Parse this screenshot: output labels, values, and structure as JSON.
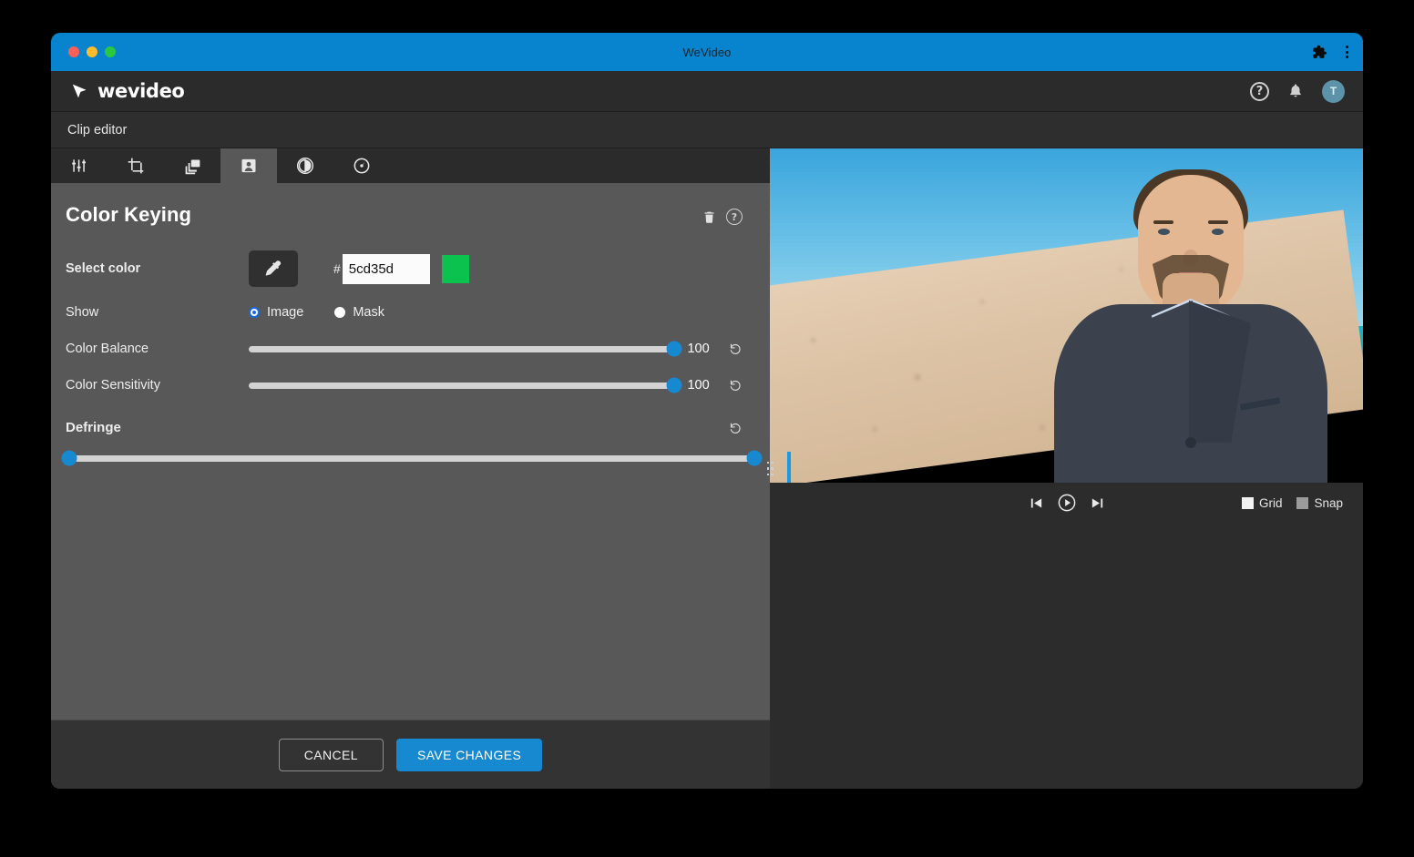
{
  "window": {
    "title": "WeVideo",
    "traffic_lights": [
      "close-red",
      "minimize-yellow",
      "maximize-green"
    ],
    "extensions_icon": "puzzle-icon",
    "menu_icon": "kebab-menu-icon"
  },
  "appbar": {
    "brand": "wevideo",
    "help_label": "?",
    "notifications_icon": "bell-icon",
    "avatar_initial": "T"
  },
  "subbar": {
    "title": "Clip editor"
  },
  "tabs": [
    {
      "id": "adjust",
      "icon": "sliders-icon",
      "active": false
    },
    {
      "id": "crop",
      "icon": "crop-icon",
      "active": false
    },
    {
      "id": "layers",
      "icon": "layers-icon",
      "active": false
    },
    {
      "id": "color-keying",
      "icon": "person-portrait-icon",
      "active": true
    },
    {
      "id": "contrast",
      "icon": "contrast-half-circle-icon",
      "active": false
    },
    {
      "id": "speed",
      "icon": "speedometer-icon",
      "active": false
    }
  ],
  "panel": {
    "title": "Color Keying",
    "delete_icon": "trash-icon",
    "help_icon": "question-circle-icon",
    "select_color": {
      "label": "Select color",
      "eyedropper_icon": "eyedropper-icon",
      "hash": "#",
      "hex_value": "5cd35d",
      "swatch_color": "#0ac24d"
    },
    "show": {
      "label": "Show",
      "options": [
        {
          "label": "Image",
          "selected": true
        },
        {
          "label": "Mask",
          "selected": false
        }
      ]
    },
    "sliders": [
      {
        "label": "Color Balance",
        "value": "100",
        "percent": 100,
        "reset_icon": "reset-arrow-icon"
      },
      {
        "label": "Color Sensitivity",
        "value": "100",
        "percent": 100,
        "reset_icon": "reset-arrow-icon"
      }
    ],
    "defringe": {
      "label": "Defringe",
      "reset_icon": "reset-arrow-icon",
      "range_low_percent": 0,
      "range_high_percent": 100
    }
  },
  "footer": {
    "cancel_label": "CANCEL",
    "save_label": "SAVE CHANGES",
    "save_color": "#1689d1"
  },
  "preview": {
    "drag_handle_icon": "vertical-grip-icon",
    "playhead": true,
    "transport": [
      {
        "id": "skip-start",
        "icon": "skip-to-start-icon"
      },
      {
        "id": "play",
        "icon": "play-circle-icon"
      },
      {
        "id": "skip-end",
        "icon": "skip-to-end-icon"
      }
    ],
    "toggles": [
      {
        "label": "Grid",
        "checked": true
      },
      {
        "label": "Snap",
        "checked": false
      }
    ]
  },
  "theme": {
    "accent_blue": "#1689d1",
    "titlebar_blue": "#0784cd",
    "panel_bg": "#585858",
    "chrome_dark": "#2b2b2b"
  }
}
